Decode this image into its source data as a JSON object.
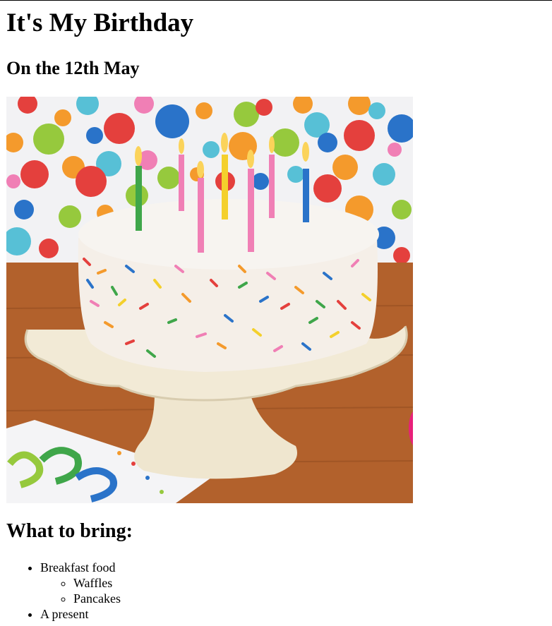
{
  "page": {
    "title": "It's My Birthday",
    "subtitle": "On the 12th May",
    "image": {
      "description_icon": "birthday-cake-photo"
    },
    "bring_heading": "What to bring:",
    "list": [
      {
        "label": "Breakfast food",
        "children": [
          "Waffles",
          "Pancakes"
        ]
      },
      {
        "label": "A present",
        "children": []
      }
    ]
  },
  "colors": {
    "background": "#ffffff",
    "text": "#000000",
    "table_wood": "#b2612c",
    "frosting": "#f7f4f0",
    "cake_stand": "#efe6cf"
  }
}
